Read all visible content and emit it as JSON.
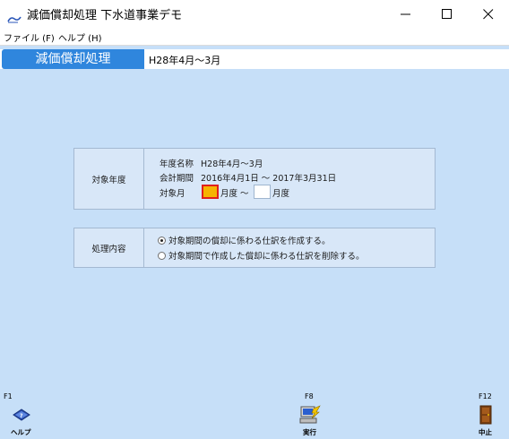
{
  "window": {
    "title": "減価償却処理 下水道事業デモ"
  },
  "menu": {
    "file": "ファイル (F)",
    "help": "ヘルプ (H)"
  },
  "header": {
    "title": "減価償却処理",
    "period": "H28年4月～3月"
  },
  "target_year": {
    "label": "対象年度",
    "year_name_label": "年度名称",
    "year_name_value": "H28年4月～3月",
    "fiscal_period_label": "会計期間",
    "fiscal_period_value": "2016年4月1日 ～ 2017年3月31日",
    "month_label": "対象月",
    "month_from": "",
    "month_to": "",
    "month_unit_1": "月度 ～",
    "month_unit_2": "月度"
  },
  "process": {
    "label": "処理内容",
    "options": [
      {
        "label": "対象期間の償却に係わる仕訳を作成する。",
        "selected": true
      },
      {
        "label": "対象期間で作成した償却に係わる仕訳を削除する。",
        "selected": false
      }
    ]
  },
  "function_keys": {
    "f1_key": "F1",
    "f1_label": "ヘルプ",
    "f8_key": "F8",
    "f8_label": "実行",
    "f12_key": "F12",
    "f12_label": "中止"
  },
  "colors": {
    "header_blue": "#2f86dd",
    "client_bg": "#c6dff8",
    "highlight_field": "#f6b400",
    "highlight_border": "#e0201c"
  }
}
